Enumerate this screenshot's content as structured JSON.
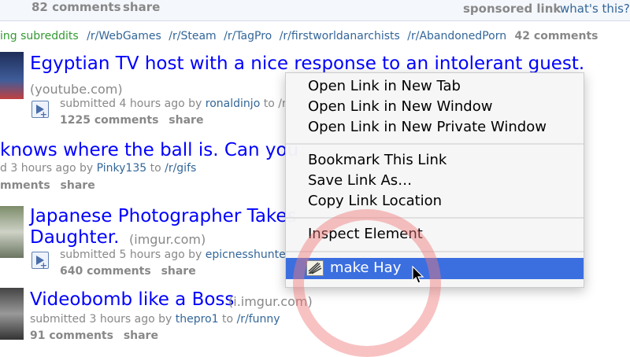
{
  "sponsor_row": {
    "comments": "82 comments",
    "share": "share",
    "sponsored": "sponsored link",
    "whats_this": "what's this?"
  },
  "trending": {
    "prefix": "ing subreddits",
    "subreddits": [
      "/r/WebGames",
      "/r/Steam",
      "/r/TagPro",
      "/r/firstworldanarchists",
      "/r/AbandonedPorn"
    ],
    "comments": "42 comments"
  },
  "posts": [
    {
      "title": "Egyptian TV host with a nice response to an intolerant guest.",
      "domain": "(youtube.com)",
      "submitted": "submitted 4 hours ago by",
      "author": "ronaldinjo",
      "to": "to /r",
      "comments": "1225 comments",
      "share": "share"
    },
    {
      "title": "knows where the ball is. Can you",
      "submitted": "d 3 hours ago by",
      "author": "Pinky135",
      "to": "to",
      "subreddit": "/r/gifs",
      "comments": "mments",
      "share": "share"
    },
    {
      "title": "Japanese Photographer Takes",
      "title2": "Daughter.",
      "domain": "(imgur.com)",
      "submitted": "submitted 5 hours ago by",
      "author": "epicnesshunter",
      "comments": "640 comments",
      "share": "share"
    },
    {
      "title": "Videobomb like a Boss",
      "domain": "(i.imgur.com)",
      "submitted": "submitted 3 hours ago by",
      "author": "thepro1",
      "to": "to",
      "subreddit": "/r/funny",
      "comments": "91 comments",
      "share": "share"
    }
  ],
  "context_menu": {
    "items": [
      "Open Link in New Tab",
      "Open Link in New Window",
      "Open Link in New Private Window",
      "Bookmark This Link",
      "Save Link As…",
      "Copy Link Location",
      "Inspect Element",
      "make Hay"
    ]
  }
}
